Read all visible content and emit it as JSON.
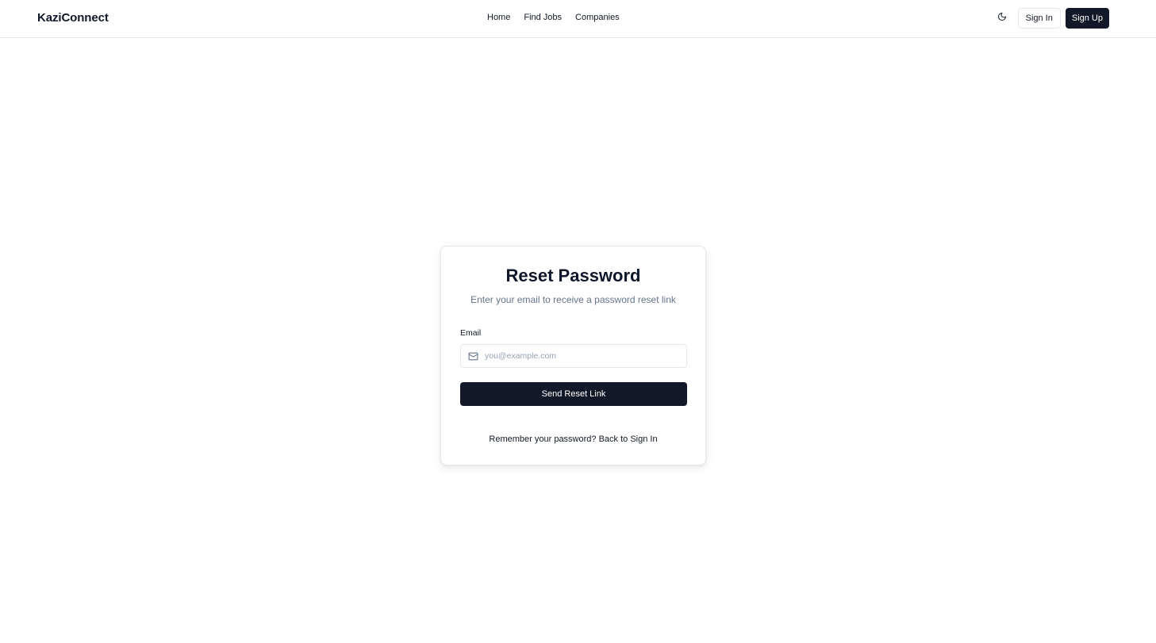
{
  "header": {
    "brand": "KaziConnect",
    "nav": [
      {
        "label": "Home"
      },
      {
        "label": "Find Jobs"
      },
      {
        "label": "Companies"
      }
    ],
    "theme_toggle_icon": "moon-icon",
    "signin_label": "Sign In",
    "signup_label": "Sign Up"
  },
  "card": {
    "title": "Reset Password",
    "subtitle": "Enter your email to receive a password reset link",
    "email_label": "Email",
    "email_value": "",
    "email_placeholder": "you@example.com",
    "email_icon": "mail-icon",
    "submit_label": "Send Reset Link",
    "footer_prompt": "Remember your password?",
    "footer_link": "Back to Sign In"
  },
  "colors": {
    "primary": "#111827",
    "muted_text": "#64748b",
    "border": "#e5e7eb"
  }
}
